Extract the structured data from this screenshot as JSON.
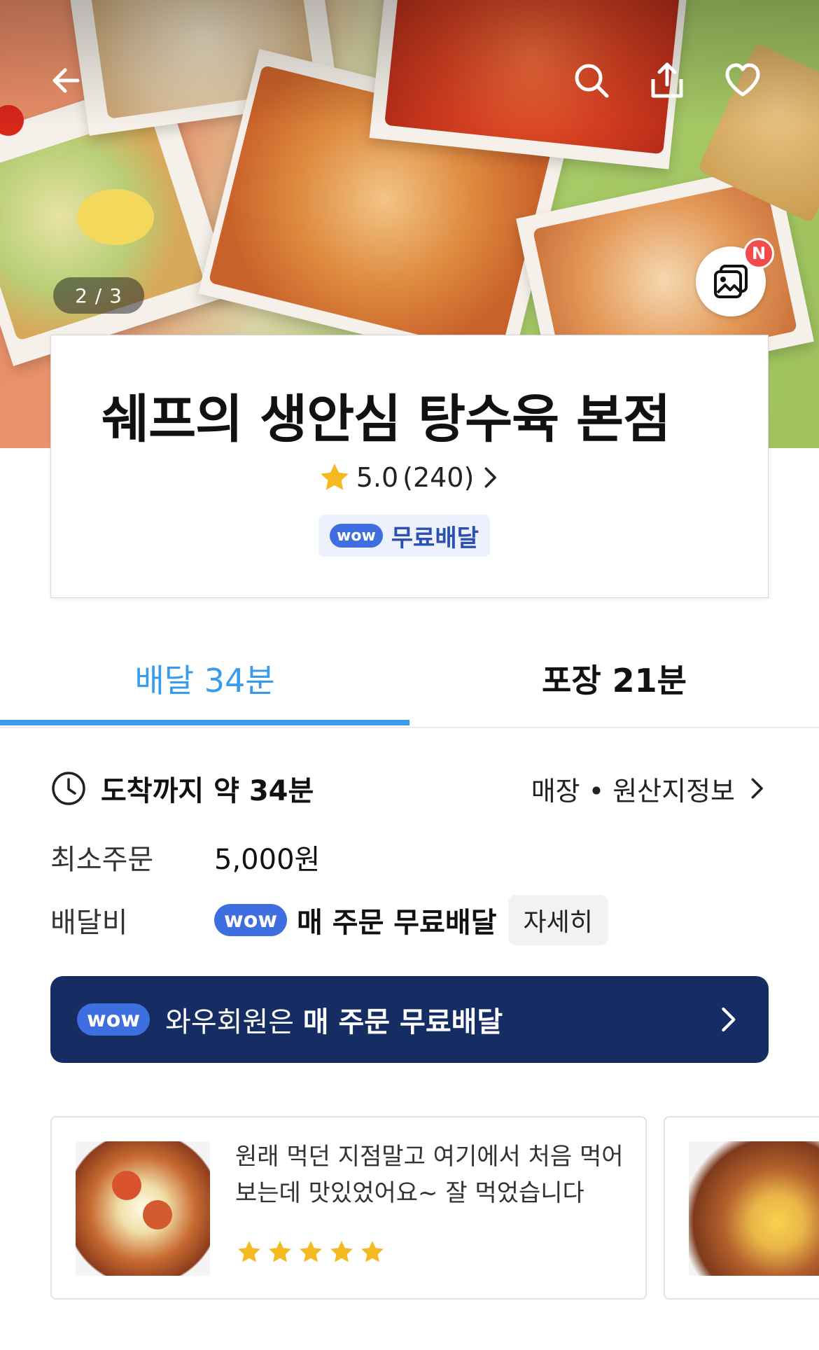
{
  "hero": {
    "photo_counter": "2 / 3",
    "new_badge": "N",
    "icons": [
      "back-arrow-icon",
      "search-icon",
      "share-icon",
      "heart-icon",
      "gallery-icon"
    ]
  },
  "store": {
    "name": "쉐프의 생안심 탕수육 본점",
    "rating": "5.0",
    "review_count": "(240)",
    "wow_label": "wow",
    "free_delivery_label": "무료배달"
  },
  "tabs": [
    {
      "label": "배달 34분",
      "active": true
    },
    {
      "label": "포장 21분",
      "active": false
    }
  ],
  "info": {
    "arrival_text": "도착까지 약 34분",
    "store_info_link": "매장 • 원산지정보",
    "min_order_label": "최소주문",
    "min_order_value": "5,000원",
    "delivery_fee_label": "배달비",
    "wow_label": "wow",
    "delivery_fee_value": "매 주문 무료배달",
    "detail_button": "자세히"
  },
  "banner": {
    "wow_label": "wow",
    "text_prefix": "와우회원은 ",
    "text_bold": "매 주문 무료배달"
  },
  "reviews": [
    {
      "text": "원래 먹던 지점말고 여기에서 처음 먹어보는데 맛있었어요~ 잘 먹었습니다",
      "stars": 5
    }
  ],
  "colors": {
    "accent_blue": "#3a9bec",
    "wow_blue": "#3e6ee0",
    "banner_navy": "#162d63",
    "star_gold": "#f5b922",
    "badge_red": "#f24b4b"
  }
}
